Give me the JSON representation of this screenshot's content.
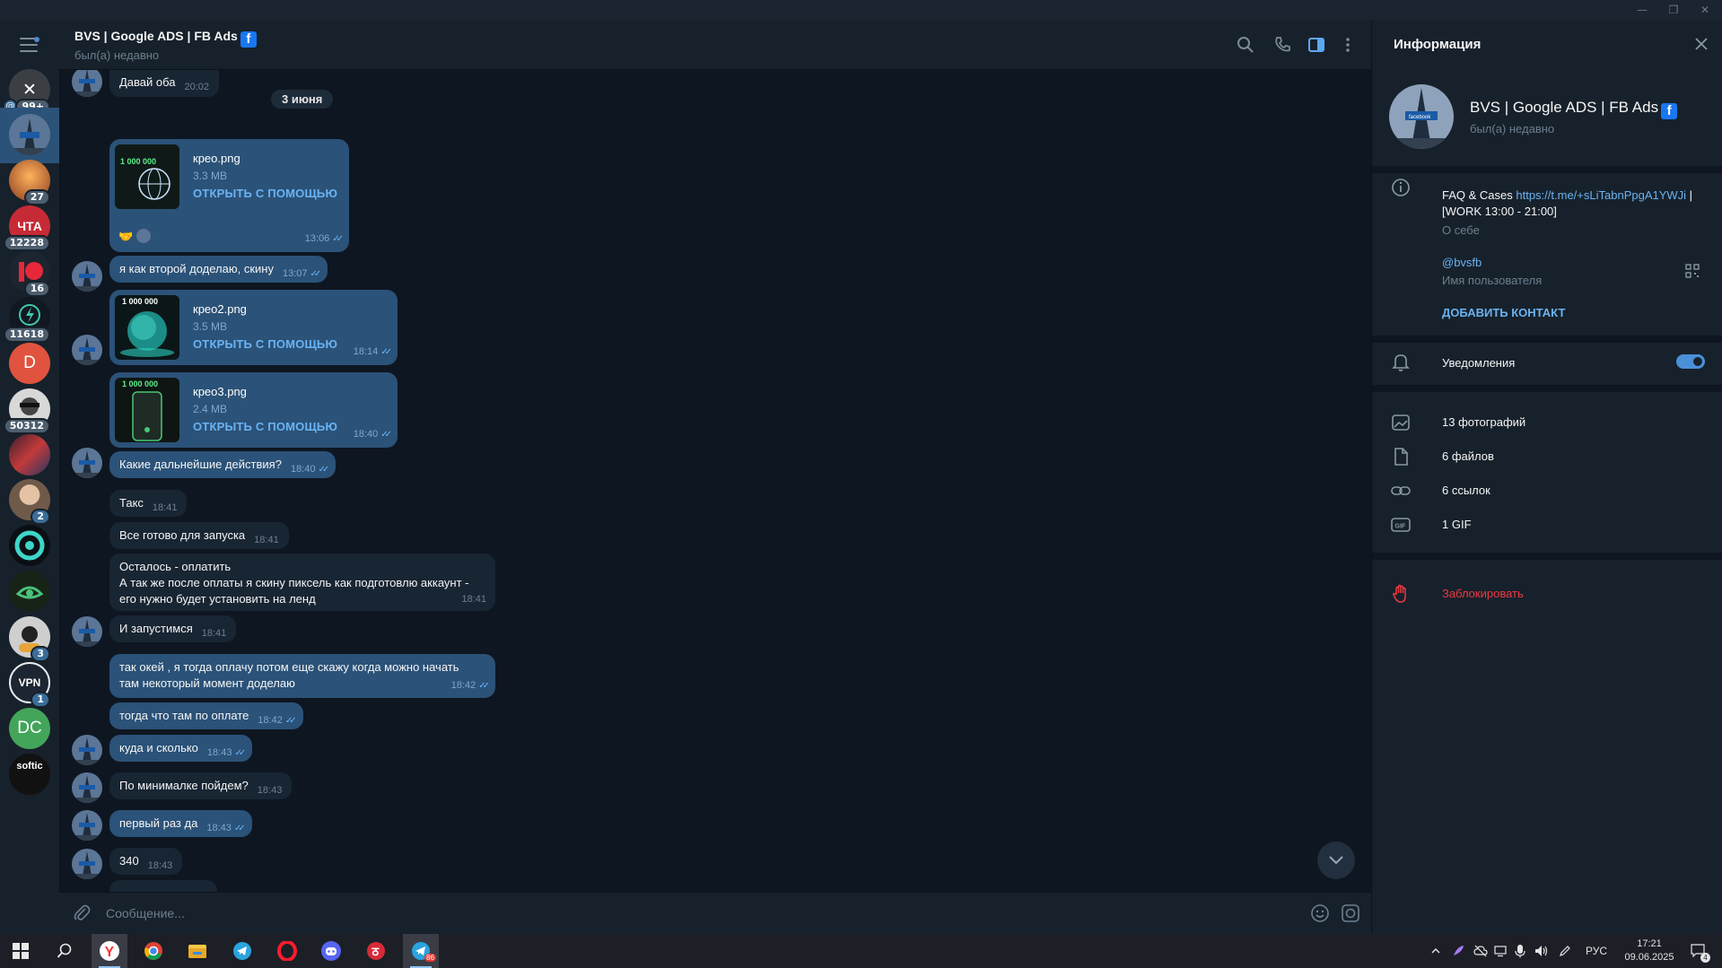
{
  "chat": {
    "title": "BVS | Google ADS | FB Ads",
    "status": "был(а) недавно"
  },
  "chat_list": {
    "items": [
      {
        "badge": "99+",
        "mention": "@",
        "color": "#3b3f44"
      },
      {
        "badge": "",
        "color": "#3b5472",
        "active": true
      },
      {
        "badge": "27",
        "color": "#b4602a"
      },
      {
        "badge": "12228",
        "color": "#c62b35",
        "letter": "ЧТА"
      },
      {
        "badge": "16",
        "color": "#1c2530"
      },
      {
        "badge": "11618",
        "color": "#111820"
      },
      {
        "badge": "",
        "color": "#e0533e",
        "letter": "D"
      },
      {
        "badge": "50312",
        "color": "#d8d8d8"
      },
      {
        "badge": "",
        "color": "#34202a"
      },
      {
        "badge": "2",
        "color": "#6f5a4a"
      },
      {
        "badge": "",
        "color": "#0b0f14"
      },
      {
        "badge": "",
        "color": "#182318"
      },
      {
        "badge": "3",
        "color": "#cfcfcf"
      },
      {
        "badge": "1",
        "color": "#1c2632",
        "letter": "VPN"
      },
      {
        "badge": "",
        "color": "#43a55a",
        "letter": "DC"
      },
      {
        "badge": "",
        "color": "#111111",
        "letter": "softic"
      }
    ]
  },
  "messages": {
    "date_separator": "3 июня",
    "m0": {
      "text": "Давай оба",
      "time": "20:02"
    },
    "f1": {
      "name": "крео.png",
      "size": "3.3 MB",
      "open": "ОТКРЫТЬ С ПОМОЩЬЮ",
      "time": "13:06",
      "reaction": "🤝"
    },
    "m2": {
      "text": "я как второй доделаю, скину",
      "time": "13:07"
    },
    "f3": {
      "name": "крео2.png",
      "size": "3.5 MB",
      "open": "ОТКРЫТЬ С ПОМОЩЬЮ",
      "time": "18:14"
    },
    "f4": {
      "name": "крео3.png",
      "size": "2.4 MB",
      "open": "ОТКРЫТЬ С ПОМОЩЬЮ",
      "time": "18:40"
    },
    "m5": {
      "text": "Какие дальнейшие действия?",
      "time": "18:40"
    },
    "m6": {
      "text": "Такс",
      "time": "18:41"
    },
    "m7": {
      "text": "Все готово для запуска",
      "time": "18:41"
    },
    "m8": {
      "text": "Осталось - оплатить\nА так же после оплаты я скину пиксель как подготовлю аккаунт -\nего нужно будет установить на ленд",
      "time": "18:41"
    },
    "m9": {
      "text": "И запустимся",
      "time": "18:41"
    },
    "m10": {
      "text": "так окей , я тогда оплачу потом еще скажу когда можно начать\nтам некоторый момент доделаю",
      "time": "18:42"
    },
    "m11": {
      "text": "тогда что там по оплате",
      "time": "18:42"
    },
    "m12": {
      "text": "куда и сколько",
      "time": "18:43"
    },
    "m13": {
      "text": "По минималке пойдем?",
      "time": "18:43"
    },
    "m14": {
      "text": "первый раз да",
      "time": "18:43"
    },
    "m15": {
      "text": "340",
      "time": "18:43"
    }
  },
  "composer": {
    "placeholder": "Сообщение..."
  },
  "info_panel": {
    "title": "Информация",
    "name": "BVS | Google ADS | FB Ads",
    "status": "был(а) недавно",
    "bio_prefix": "FAQ & Cases ",
    "bio_link": "https://t.me/+sLiTabnPpgA1YWJi",
    "bio_suffix": " |",
    "bio_line2": "[WORK 13:00 - 21:00]",
    "bio_label": "О себе",
    "username": "@bvsfb",
    "username_label": "Имя пользователя",
    "add_contact": "ДОБАВИТЬ КОНТАКТ",
    "notifications": "Уведомления",
    "notifications_on": true,
    "media": {
      "photos": "13 фотографий",
      "files": "6 файлов",
      "links": "6 ссылок",
      "gif": "1 GIF"
    },
    "block": "Заблокировать"
  },
  "taskbar": {
    "lang": "РУС",
    "time": "17:21",
    "date": "09.06.2025",
    "telegram_badge": "86",
    "notif_count": "4"
  },
  "colors": {
    "accent": "#2b5278",
    "link": "#6ab3f3",
    "danger": "#ec3942",
    "bg": "#0e1621",
    "panel": "#17212b"
  }
}
